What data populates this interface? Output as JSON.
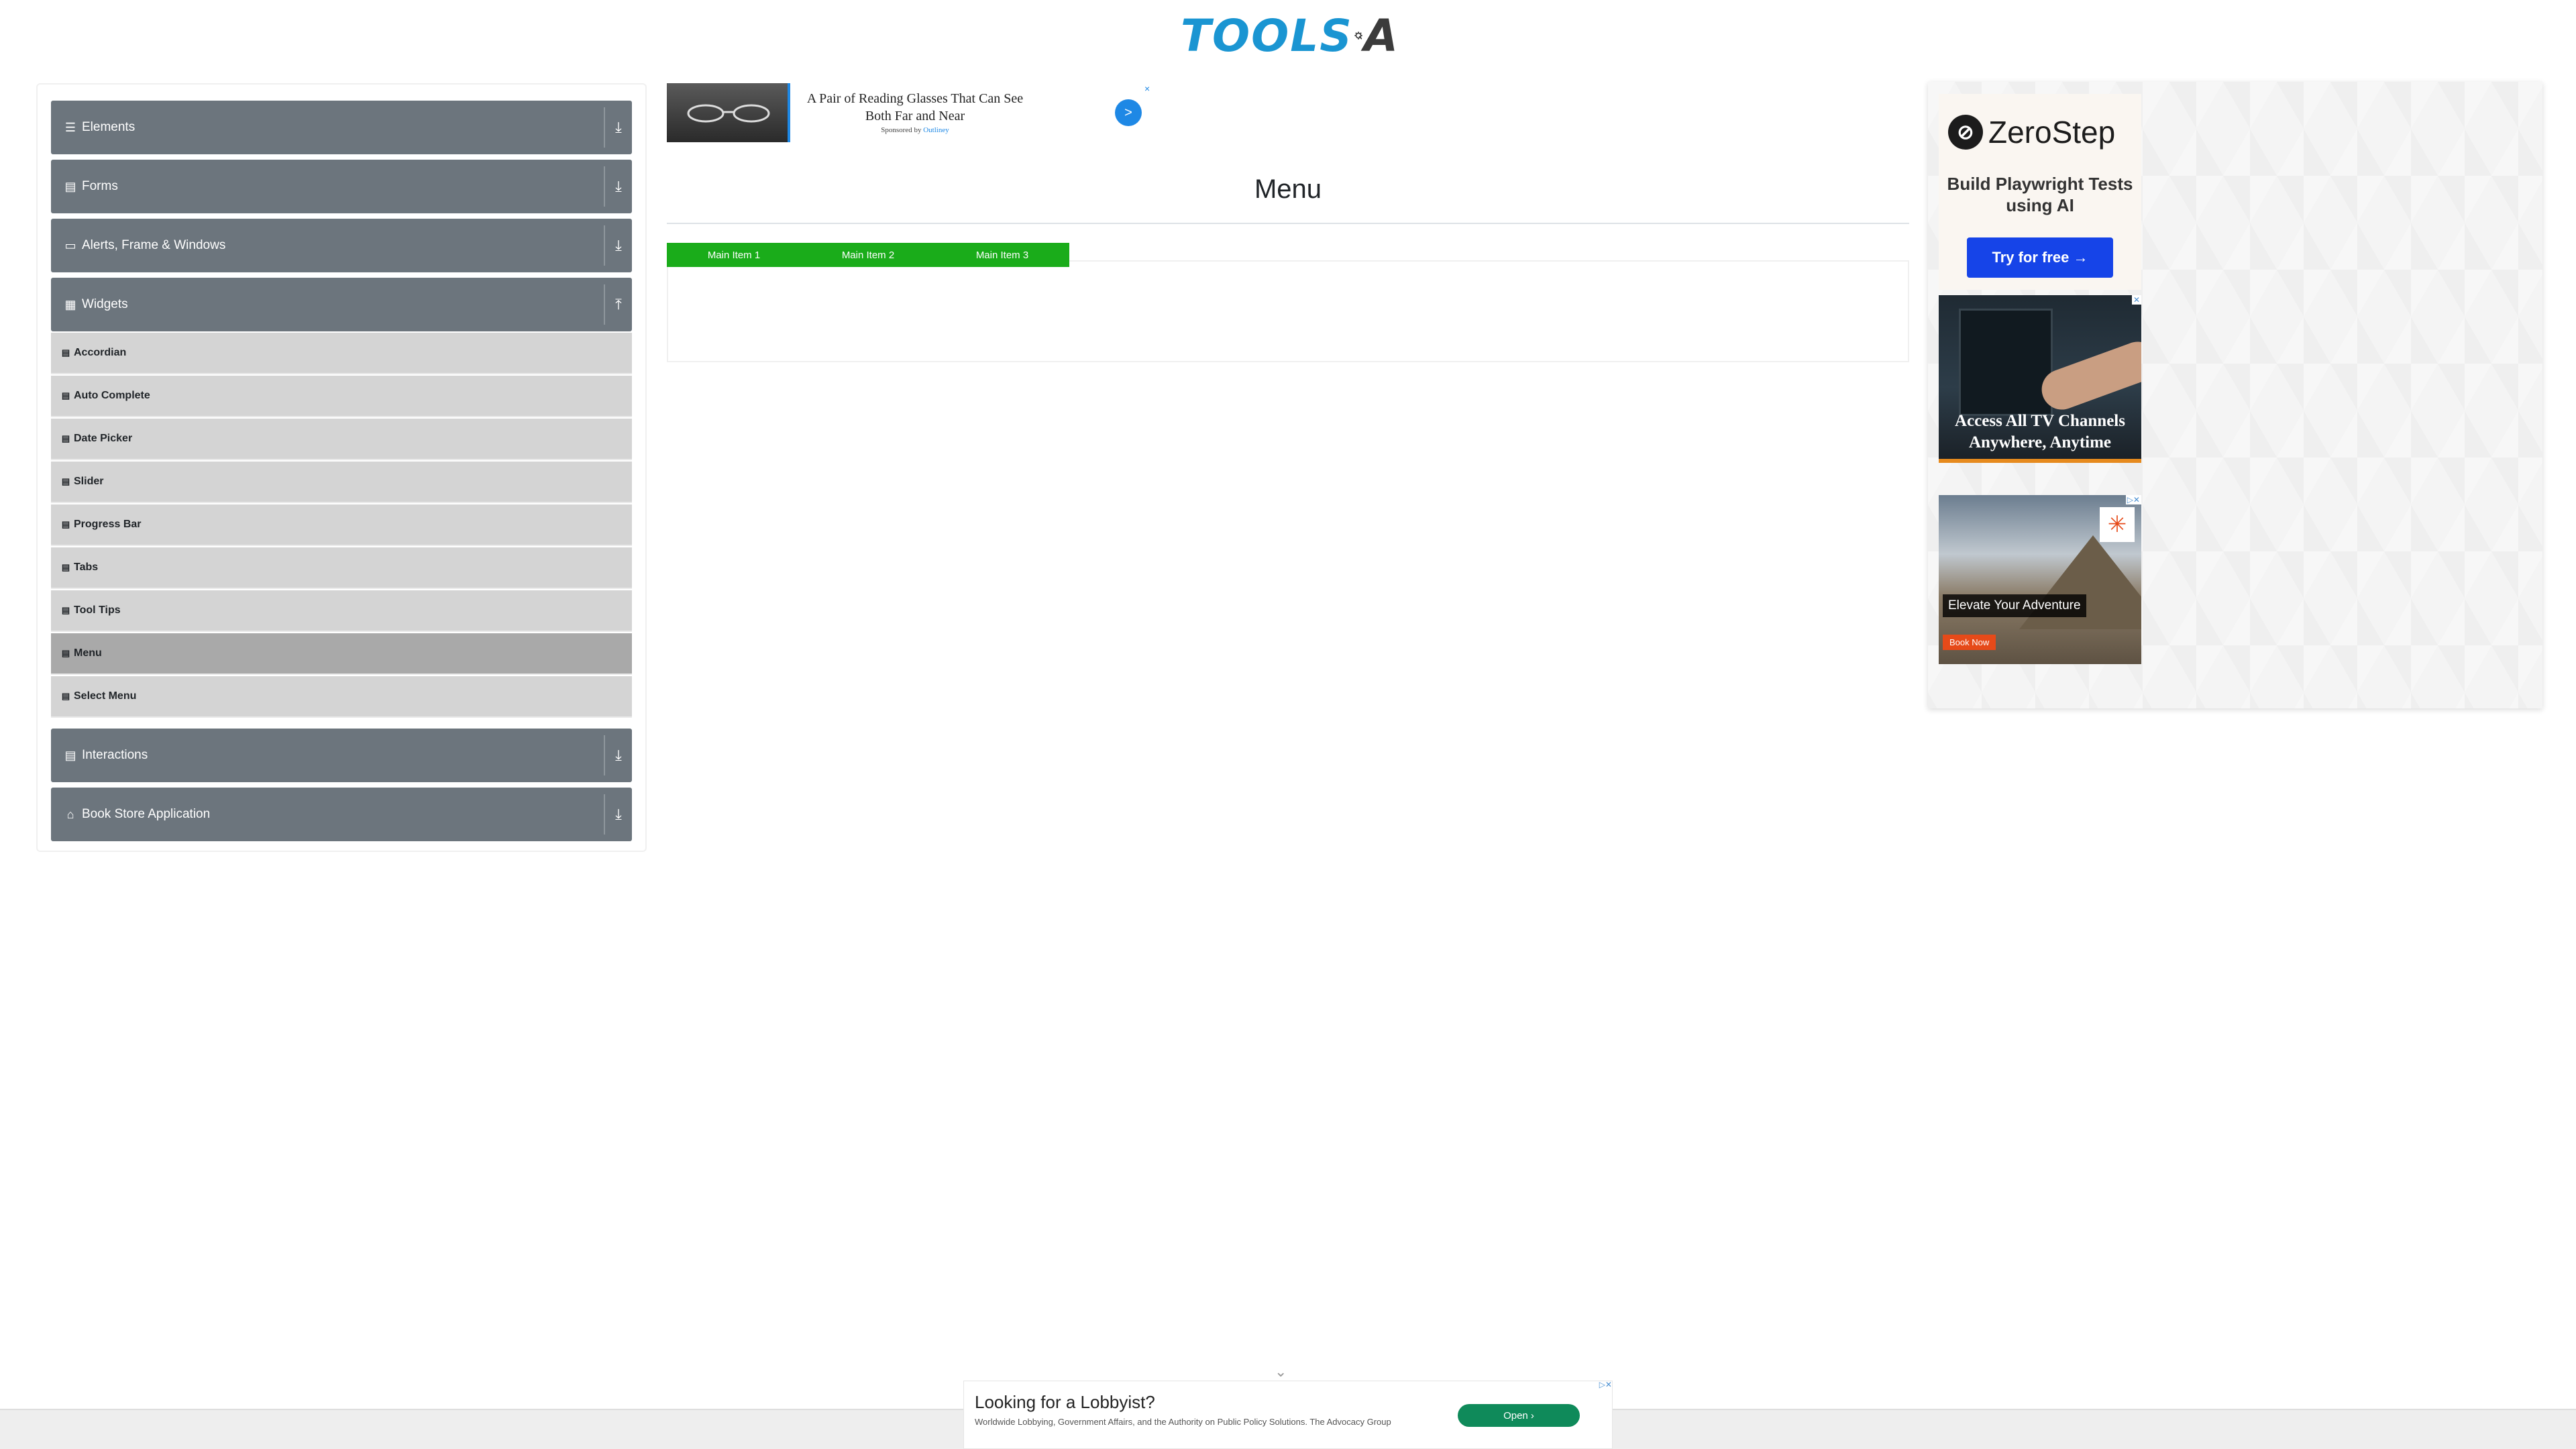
{
  "header": {
    "logo_left": "TOOLS",
    "logo_right": "A"
  },
  "sidebar": {
    "groups": [
      {
        "label": "Elements",
        "icon": "hamburger-icon"
      },
      {
        "label": "Forms",
        "icon": "document-icon"
      },
      {
        "label": "Alerts, Frame & Windows",
        "icon": "window-icon"
      },
      {
        "label": "Widgets",
        "icon": "grid-icon",
        "expanded": true
      },
      {
        "label": "Interactions",
        "icon": "document-icon"
      },
      {
        "label": "Book Store Application",
        "icon": "bookstore-icon"
      }
    ],
    "widgets_items": [
      {
        "label": "Accordian"
      },
      {
        "label": "Auto Complete"
      },
      {
        "label": "Date Picker"
      },
      {
        "label": "Slider"
      },
      {
        "label": "Progress Bar"
      },
      {
        "label": "Tabs"
      },
      {
        "label": "Tool Tips"
      },
      {
        "label": "Menu",
        "active": true
      },
      {
        "label": "Select Menu"
      }
    ]
  },
  "top_ad": {
    "headline": "A Pair of Reading Glasses That Can See Both Far and Near",
    "sponsored_prefix": "Sponsored by",
    "sponsor": "Outliney",
    "go_label": ">",
    "close_label": "×"
  },
  "main": {
    "title": "Menu",
    "menu_items": [
      "Main Item 1",
      "Main Item 2",
      "Main Item 3"
    ],
    "menu_color": "#1aac1a"
  },
  "right_ads": {
    "zerostep": {
      "name": "ZeroStep",
      "tagline": "Build Playwright Tests using AI",
      "button": "Try for free →"
    },
    "tv": {
      "headline": "Access All TV Channels Anywhere, Anytime"
    },
    "adventure": {
      "headline": "Elevate Your Adventure",
      "button": "Book Now"
    }
  },
  "bottom_ad": {
    "headline": "Looking for a Lobbyist?",
    "description": "Worldwide Lobbying, Government Affairs, and the Authority on Public Policy Solutions. The Advocacy Group",
    "button": "Open"
  },
  "colors": {
    "sidebar_header": "#6c757d",
    "sub_item": "#d4d4d4",
    "sub_item_active": "#a9a9a9",
    "brand": "#1a95d2"
  }
}
